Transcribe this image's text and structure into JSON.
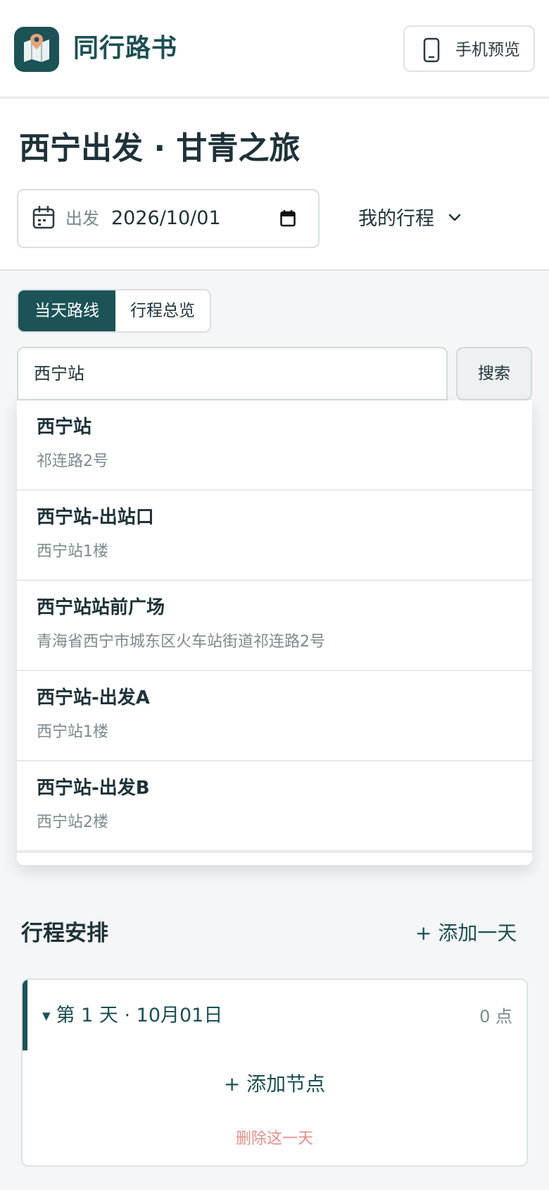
{
  "header": {
    "app_title": "同行路书",
    "preview_label": "手机预览",
    "logo_icon": "map-pin-icon",
    "preview_icon": "phone-icon"
  },
  "trip": {
    "title": "西宁出发 · 甘青之旅",
    "date_label": "出发",
    "date_value": "2026/10/01",
    "my_trips_label": "我的行程"
  },
  "tabs": [
    {
      "label": "当天路线",
      "active": true
    },
    {
      "label": "行程总览",
      "active": false
    }
  ],
  "search": {
    "value": "西宁站",
    "button_label": "搜索"
  },
  "suggestions": [
    {
      "name": "西宁站",
      "address": "祁连路2号"
    },
    {
      "name": "西宁站-出站口",
      "address": "西宁站1楼"
    },
    {
      "name": "西宁站站前广场",
      "address": "青海省西宁市城东区火车站街道祁连路2号"
    },
    {
      "name": "西宁站-出发A",
      "address": "西宁站1楼"
    },
    {
      "name": "西宁站-出发B",
      "address": "西宁站2楼"
    }
  ],
  "schedule": {
    "title": "行程安排",
    "add_day_label": "+ 添加一天",
    "days": [
      {
        "header": "第 1 天 · 10月01日",
        "count": "0 点",
        "add_node_label": "+ 添加节点",
        "delete_label": "删除这一天"
      }
    ]
  },
  "colors": {
    "brand": "#1c5356",
    "danger": "#e0908a",
    "background": "#f4f6f7"
  }
}
